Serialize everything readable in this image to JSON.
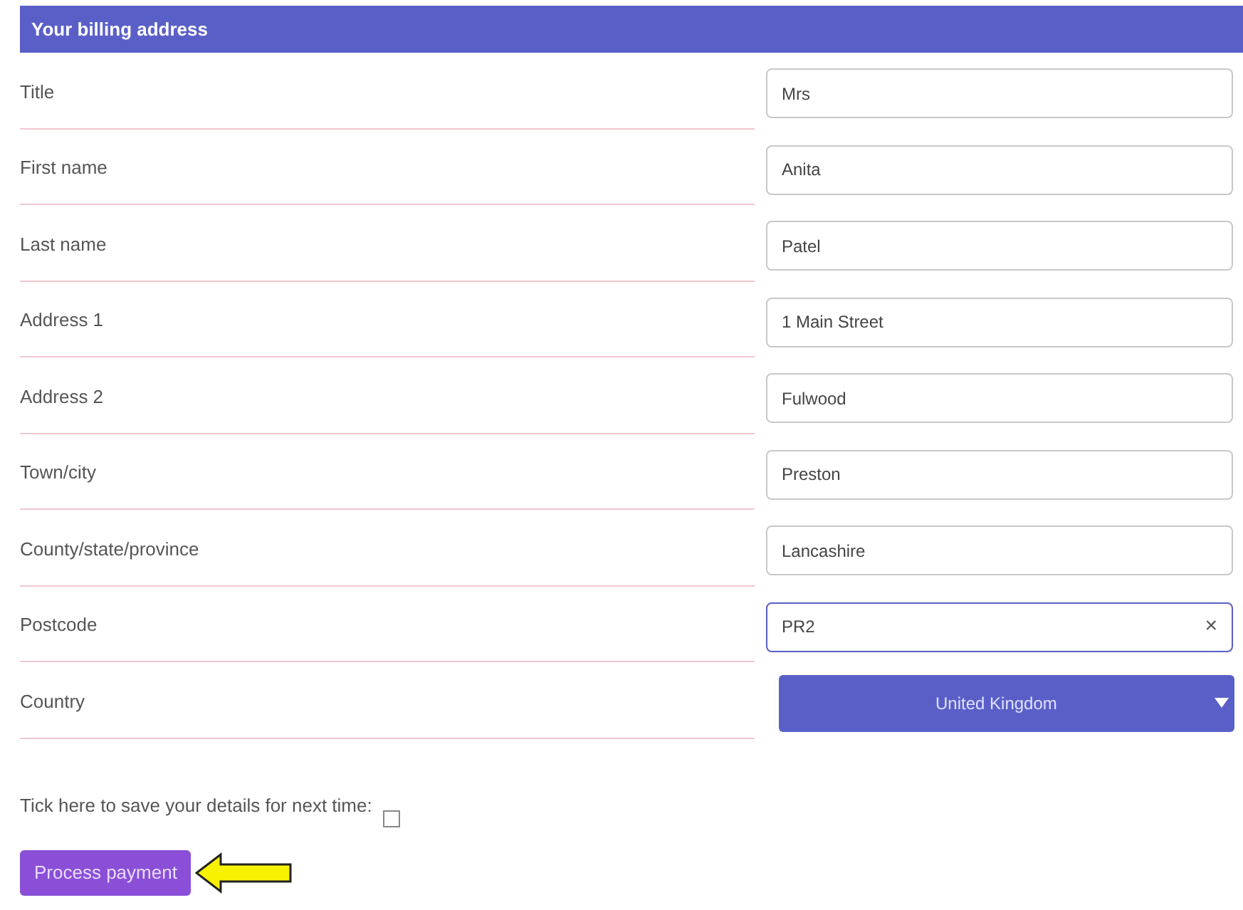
{
  "section": {
    "title": "Your billing address"
  },
  "fields": [
    {
      "kind": "text",
      "label": "Title",
      "value": "Mrs",
      "focused": false
    },
    {
      "kind": "text",
      "label": "First name",
      "value": "Anita",
      "focused": false
    },
    {
      "kind": "text",
      "label": "Last name",
      "value": "Patel",
      "focused": false
    },
    {
      "kind": "text",
      "label": "Address 1",
      "value": "1 Main Street",
      "focused": false
    },
    {
      "kind": "text",
      "label": "Address 2",
      "value": "Fulwood",
      "focused": false
    },
    {
      "kind": "text",
      "label": "Town/city",
      "value": "Preston",
      "focused": false
    },
    {
      "kind": "text",
      "label": "County/state/province",
      "value": "Lancashire",
      "focused": false
    },
    {
      "kind": "text",
      "label": "Postcode",
      "value": "PR2",
      "focused": true,
      "clear": "×"
    },
    {
      "kind": "select",
      "label": "Country",
      "value": "United Kingdom"
    }
  ],
  "save_details": {
    "label": "Tick here to save your details for next time:",
    "checked": false
  },
  "submit": {
    "label": "Process payment"
  }
}
